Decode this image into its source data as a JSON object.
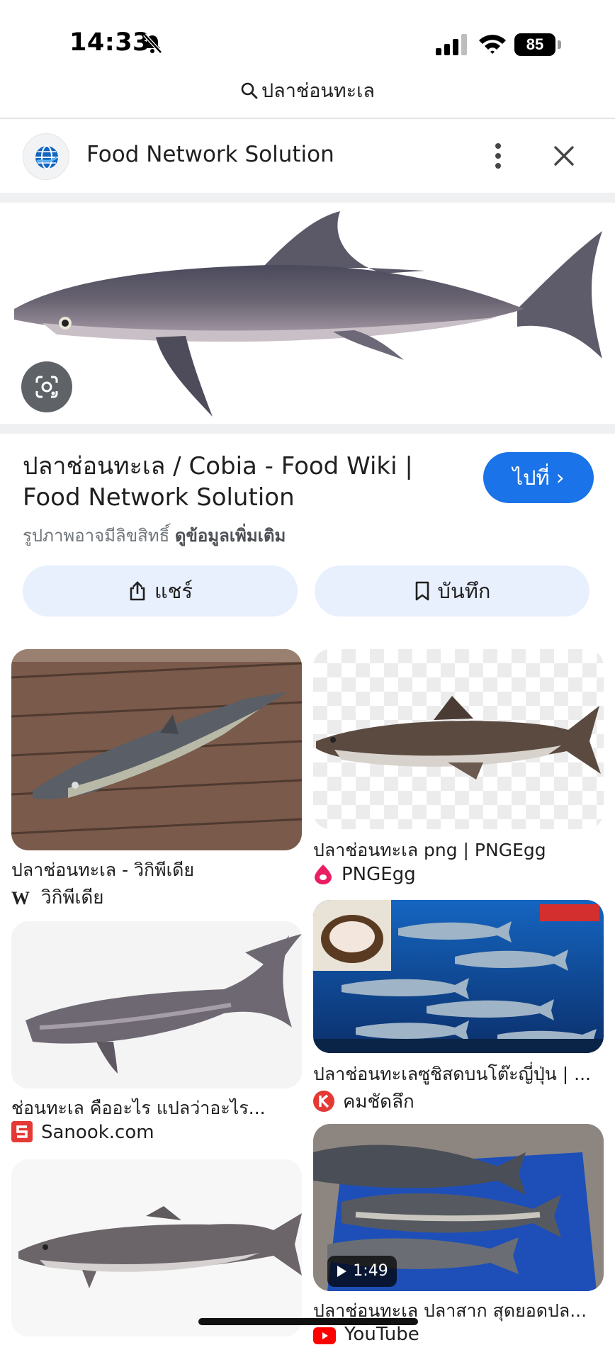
{
  "status_bar": {
    "time": "14:33",
    "battery": "85"
  },
  "search": {
    "query": "ปลาช่อนทะเล"
  },
  "source": {
    "site_name": "Food Network Solution"
  },
  "result": {
    "title": "ปลาช่อนทะเล / Cobia - Food Wiki | Food Network Solution",
    "copyright_note": "รูปภาพอาจมีลิขสิทธิ์",
    "more_info": "ดูข้อมูลเพิ่มเติม",
    "visit_label": "ไปที่ ›",
    "share_label": "แชร์",
    "save_label": "บันทึก"
  },
  "related": [
    {
      "title": "ปลาช่อนทะเล - วิกิพีเดีย",
      "source": "วิกิพีเดีย",
      "source_icon": "wikipedia-icon"
    },
    {
      "title": "ปลาช่อนทะเล png | PNGEgg",
      "source": "PNGEgg",
      "source_icon": "pngegg-icon"
    },
    {
      "title": "ช่อนทะเล คืออะไร แปลว่าอะไร...",
      "source": "Sanook.com",
      "source_icon": "sanook-icon"
    },
    {
      "title": "ปลาช่อนทะเลซูชิสดบนโต๊ะญี่ปุ่น | ...",
      "source": "คมชัดลึก",
      "source_icon": "komchadluek-icon"
    },
    {
      "title": "ปลาช่อนทะเล ปลาสาก สุดยอดปล...",
      "source": "YouTube",
      "source_icon": "youtube-icon",
      "duration": "1:49"
    }
  ],
  "colors": {
    "accent": "#1a73e8",
    "action_bg": "#e8f0fe"
  }
}
